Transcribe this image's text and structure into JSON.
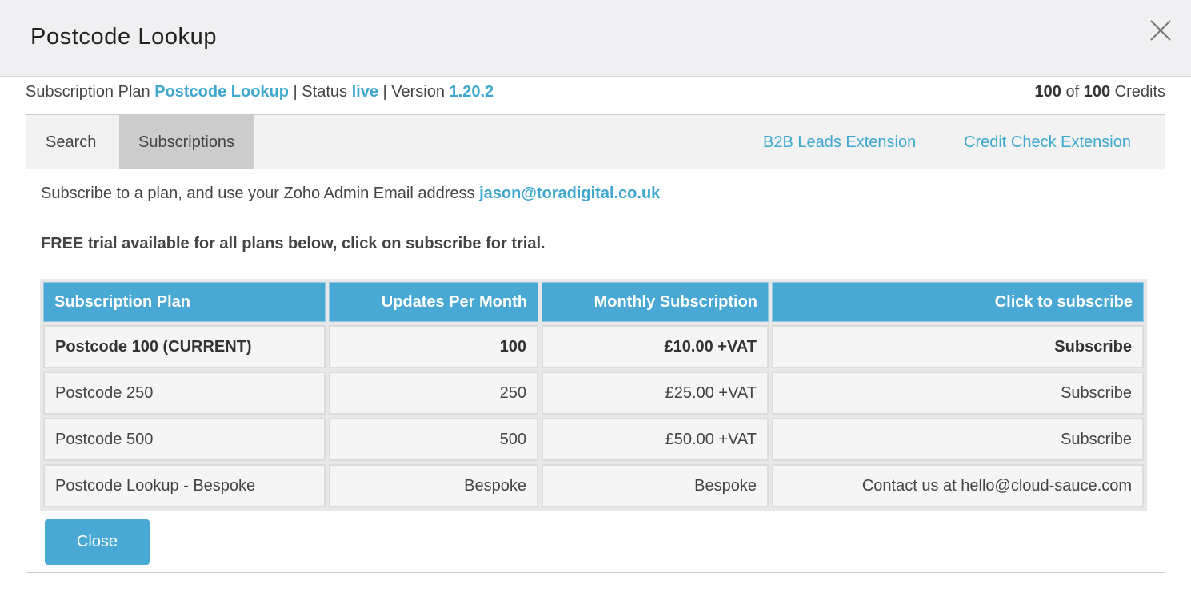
{
  "modal": {
    "title": "Postcode Lookup"
  },
  "info": {
    "plan_prefix": "Subscription Plan ",
    "plan_name": "Postcode Lookup",
    "status_prefix": " | Status ",
    "status": "live",
    "version_prefix": " | Version ",
    "version": "1.20.2",
    "credits_used": "100",
    "credits_of": " of ",
    "credits_total": "100",
    "credits_label": " Credits"
  },
  "tabs": [
    {
      "label": "Search"
    },
    {
      "label": "Subscriptions"
    },
    {
      "label": "B2B Leads Extension"
    },
    {
      "label": "Credit Check Extension"
    }
  ],
  "content": {
    "intro_text": "Subscribe to a plan, and use your Zoho Admin Email address ",
    "email": "jason@toradigital.co.uk",
    "trial_text": "FREE trial available for all plans below, click on subscribe for trial."
  },
  "table": {
    "headers": [
      "Subscription Plan",
      "Updates Per Month",
      "Monthly Subscription",
      "Click to subscribe"
    ],
    "rows": [
      {
        "plan": "Postcode 100 (CURRENT)",
        "updates": "100",
        "price": "£10.00 +VAT",
        "action": "Subscribe"
      },
      {
        "plan": "Postcode 250",
        "updates": "250",
        "price": "£25.00 +VAT",
        "action": "Subscribe"
      },
      {
        "plan": "Postcode 500",
        "updates": "500",
        "price": "£50.00 +VAT",
        "action": "Subscribe"
      },
      {
        "plan": "Postcode Lookup - Bespoke",
        "updates": "Bespoke",
        "price": "Bespoke",
        "action": "Contact us at hello@cloud-sauce.com"
      }
    ]
  },
  "buttons": {
    "close_label": "Close"
  },
  "icons": {
    "close": "close-x-icon"
  },
  "colors": {
    "accent": "#4aa9d4",
    "link": "#3ea8d0",
    "header_bg": "#f0f0f2"
  }
}
